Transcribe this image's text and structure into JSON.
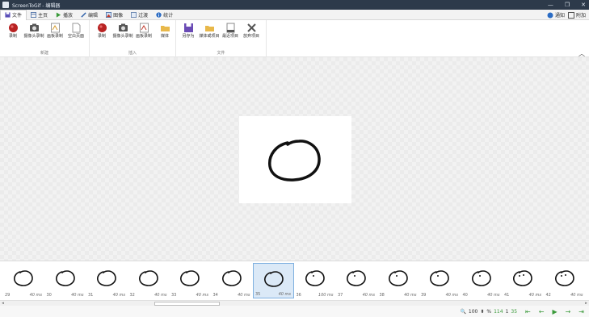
{
  "window": {
    "title": "ScreenToGif - 编辑器",
    "controls": [
      "minimize",
      "restore",
      "close"
    ]
  },
  "tabs": [
    {
      "label": "文件",
      "icon": "save-icon",
      "active": true
    },
    {
      "label": "主页",
      "icon": "home-icon",
      "active": false
    },
    {
      "label": "播放",
      "icon": "play-icon",
      "active": false
    },
    {
      "label": "编辑",
      "icon": "pencil-icon",
      "active": false
    },
    {
      "label": "图像",
      "icon": "image-icon",
      "active": false
    },
    {
      "label": "过渡",
      "icon": "transition-icon",
      "active": false
    },
    {
      "label": "统计",
      "icon": "info-icon",
      "active": false
    }
  ],
  "tab_right": {
    "notifications_label": "通知",
    "attach_label": "附加"
  },
  "ribbon": {
    "groups": [
      {
        "label": "新建",
        "buttons": [
          {
            "label": "录制",
            "icon": "record-icon"
          },
          {
            "label": "摄像头录制",
            "icon": "camera-icon"
          },
          {
            "label": "画板录制",
            "icon": "board-icon"
          },
          {
            "label": "空白页面",
            "icon": "blank-page-icon"
          }
        ]
      },
      {
        "label": "插入",
        "buttons": [
          {
            "label": "录制",
            "icon": "record-icon"
          },
          {
            "label": "摄像头录制",
            "icon": "camera-icon"
          },
          {
            "label": "画板录制",
            "icon": "board-icon"
          },
          {
            "label": "媒体",
            "icon": "folder-icon"
          }
        ]
      },
      {
        "label": "文件",
        "buttons": [
          {
            "label": "另存为",
            "icon": "save-as-icon"
          },
          {
            "label": "媒体或项目",
            "icon": "folder-icon"
          },
          {
            "label": "最近项目",
            "icon": "recent-icon"
          },
          {
            "label": "放弃项目",
            "icon": "discard-icon"
          }
        ]
      }
    ]
  },
  "filmstrip": {
    "frames": [
      {
        "index": "29",
        "duration": "40 ms",
        "selected": false,
        "eyes": 0
      },
      {
        "index": "30",
        "duration": "40 ms",
        "selected": false,
        "eyes": 0
      },
      {
        "index": "31",
        "duration": "40 ms",
        "selected": false,
        "eyes": 0
      },
      {
        "index": "32",
        "duration": "40 ms",
        "selected": false,
        "eyes": 0
      },
      {
        "index": "33",
        "duration": "40 ms",
        "selected": false,
        "eyes": 0
      },
      {
        "index": "34",
        "duration": "40 ms",
        "selected": false,
        "eyes": 0
      },
      {
        "index": "35",
        "duration": "40 ms",
        "selected": true,
        "eyes": 0
      },
      {
        "index": "36",
        "duration": "100 ms",
        "selected": false,
        "eyes": 1
      },
      {
        "index": "37",
        "duration": "40 ms",
        "selected": false,
        "eyes": 1
      },
      {
        "index": "38",
        "duration": "40 ms",
        "selected": false,
        "eyes": 1
      },
      {
        "index": "39",
        "duration": "40 ms",
        "selected": false,
        "eyes": 1
      },
      {
        "index": "40",
        "duration": "40 ms",
        "selected": false,
        "eyes": 1
      },
      {
        "index": "41",
        "duration": "40 ms",
        "selected": false,
        "eyes": 2
      },
      {
        "index": "42",
        "duration": "40 ms",
        "selected": false,
        "eyes": 2
      }
    ]
  },
  "status": {
    "zoom": "100",
    "zoom_unit": "%",
    "frame_count": "114",
    "selected_count": "1",
    "current_frame": "35"
  }
}
